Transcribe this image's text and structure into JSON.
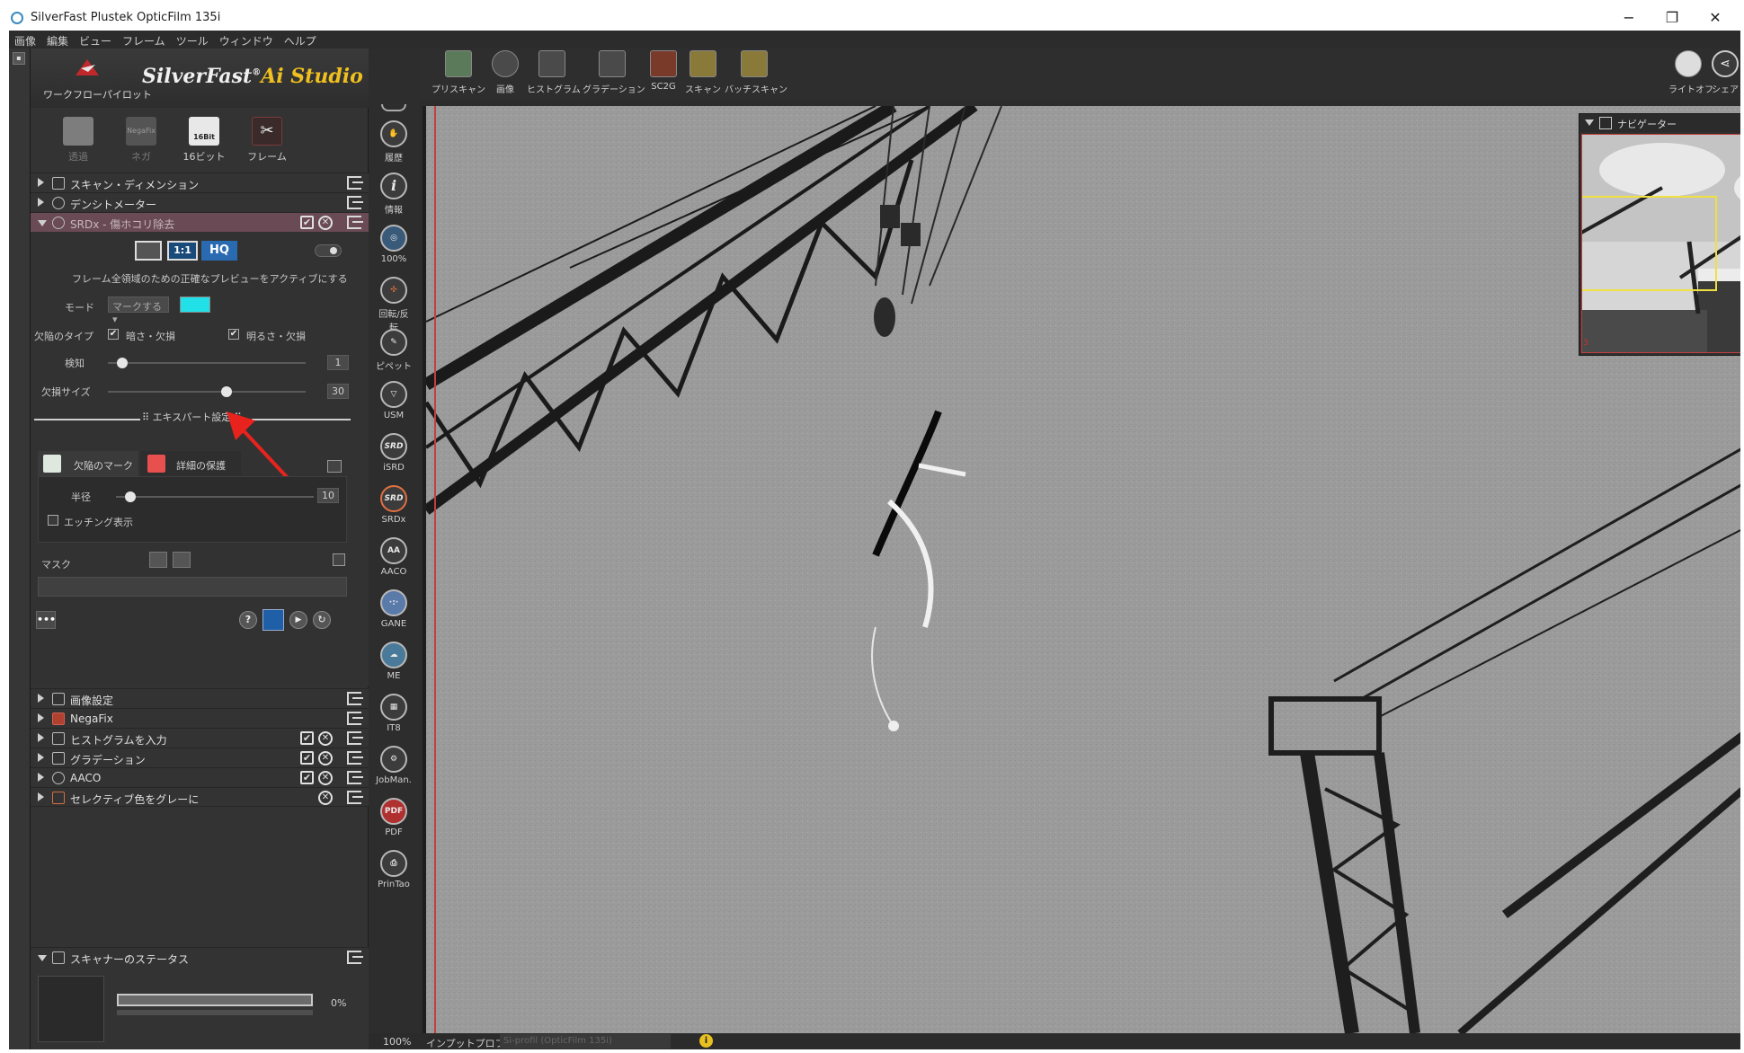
{
  "window": {
    "title": "SilverFast Plustek OpticFilm 135i",
    "controls": {
      "minimize": "−",
      "maximize": "❐",
      "close": "✕"
    }
  },
  "menubar": [
    "画像",
    "編集",
    "ビュー",
    "フレーム",
    "ツール",
    "ウィンドウ",
    "ヘルプ"
  ],
  "brand": {
    "workflow_label": "ワークフローパイロット",
    "name": "SilverFast",
    "reg": "®",
    "suffix": "Ai Studio"
  },
  "modes": [
    {
      "label": "透過",
      "dim": true
    },
    {
      "label": "ネガ",
      "icon_text": "NegaFix",
      "dim": true
    },
    {
      "label": "16ビット",
      "icon_text": "16Bit",
      "dim": false
    },
    {
      "label": "フレーム",
      "dim": false
    }
  ],
  "sections_top": [
    {
      "label": "スキャン・ディメンション",
      "icon": "dimension-icon"
    },
    {
      "label": "デンシトメーター",
      "icon": "crosshair-icon"
    }
  ],
  "srdx": {
    "label": "SRDx - 傷ホコリ除去",
    "view_btns": [
      "",
      "1:1",
      "HQ"
    ],
    "hint": "フレーム全領域のための正確なプレビューをアクティブにする",
    "mode_label": "モード",
    "mode_value": "マークする",
    "mark_color": "#22e0e8",
    "defect_type_label": "欠陥のタイプ",
    "defect_dark": "暗さ・欠損",
    "defect_light": "明るさ・欠損",
    "detect_label": "検知",
    "detect_value": "1",
    "detect_level": 0.07,
    "size_label": "欠損サイズ",
    "size_value": "30",
    "size_level": 0.58,
    "expert_label": "エキスパート設定",
    "tabs": [
      "欠陥のマーク",
      "詳細の保護"
    ],
    "radius_label": "半径",
    "radius_value": "10",
    "radius_level": 0.05,
    "etching_label": "エッチング表示",
    "mask_label": "マスク",
    "more_label": "•••"
  },
  "sections_bottom": [
    {
      "label": "画像設定",
      "icon": "settings-icon",
      "check": false,
      "x": false
    },
    {
      "label": "NegaFix",
      "icon": "negafix-icon",
      "check": false,
      "x": false
    },
    {
      "label": "ヒストグラムを入力",
      "icon": "histogram-icon",
      "check": true,
      "x": true
    },
    {
      "label": "グラデーション",
      "icon": "gradation-icon",
      "check": true,
      "x": true
    },
    {
      "label": "AACO",
      "icon": "aaco-icon",
      "check": true,
      "x": true
    },
    {
      "label": "セレクティブ色をグレーに",
      "icon": "selective-color-icon",
      "check": false,
      "x": true
    }
  ],
  "scanner_status": {
    "label": "スキャナーのステータス",
    "progress_text": "0%",
    "progress": 0
  },
  "toolbar_left": [
    {
      "label": "履歴",
      "glyph": "✋"
    },
    {
      "label": "情報",
      "glyph": "i"
    },
    {
      "label": "100%",
      "glyph": "🔍"
    },
    {
      "label": "回転/反転",
      "glyph": "⟲"
    },
    {
      "label": "ピペット",
      "glyph": "✎"
    },
    {
      "label": "USM",
      "glyph": "▽"
    },
    {
      "label": "iSRD",
      "glyph": "SRD"
    },
    {
      "label": "SRDx",
      "glyph": "SRD"
    },
    {
      "label": "AACO",
      "glyph": "AA"
    },
    {
      "label": "GANE",
      "glyph": "·"
    },
    {
      "label": "ME",
      "glyph": "☁"
    },
    {
      "label": "IT8",
      "glyph": "▦"
    },
    {
      "label": "JobMan.",
      "glyph": "⚙"
    },
    {
      "label": "PDF",
      "glyph": "PDF"
    },
    {
      "label": "PrinTao",
      "glyph": "⎙"
    }
  ],
  "toolbar_top": [
    {
      "label": "プリスキャン"
    },
    {
      "label": "画像"
    },
    {
      "label": "ヒストグラム"
    },
    {
      "label": "グラデーション"
    },
    {
      "label": "SC2G"
    },
    {
      "label": "スキャン"
    },
    {
      "label": "バッチスキャン"
    }
  ],
  "toolbar_right": [
    {
      "label": "ライトオフ"
    },
    {
      "label": "シェア"
    }
  ],
  "navigator": {
    "title": "ナビゲーター",
    "corner_num": "3"
  },
  "bottom": {
    "zoom": "100%",
    "input_profile_label": "インプットプロファイル",
    "input_profile_value": "Si-profil (OpticFilm 135i)"
  }
}
